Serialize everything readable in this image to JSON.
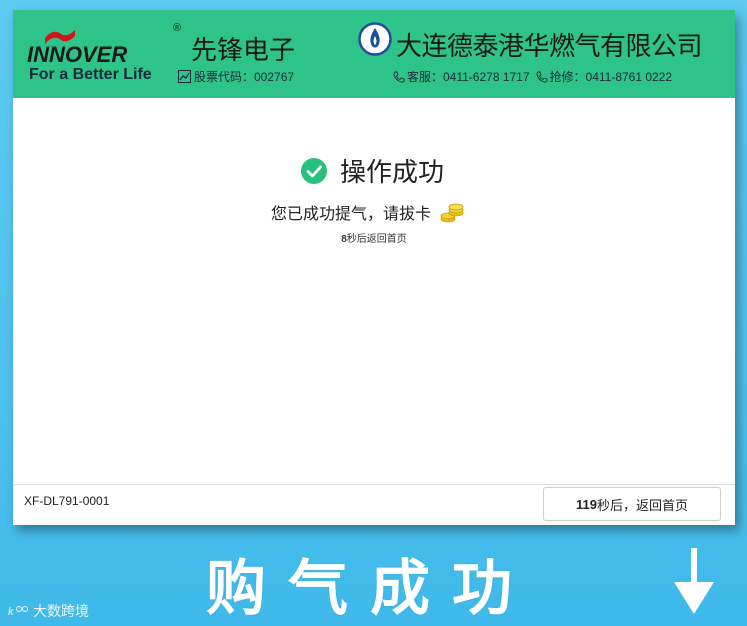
{
  "header": {
    "brand_wordmark": "INNOVER",
    "brand_reg": "®",
    "brand_cn": "先锋电子",
    "tagline": "For a Better Life",
    "stock_label": "股票代码：002767",
    "company_name": "大连德泰港华燃气有限公司",
    "service_label": "客服：0411-6278 1717",
    "emergency_label": "抢修：0411-8761 0222",
    "header_color": "#2ec388"
  },
  "main": {
    "status_title": "操作成功",
    "message": "您已成功提气，请拔卡",
    "auto_return_seconds": "8",
    "auto_return_text": "秒后返回首页",
    "success_color": "#27c07d"
  },
  "footer": {
    "device_id": "XF-DL791-0001",
    "return_seconds": "119",
    "return_text": "秒后，返回首页"
  },
  "banner": {
    "caption": "购气成功",
    "watermark": "大数跨境"
  },
  "icons": {
    "stock": "chart-icon",
    "service": "phone-icon",
    "emergency": "phone-icon",
    "status": "check-circle-icon",
    "coins": "coins-icon",
    "company": "gas-flame-logo-icon",
    "arrow": "arrow-down-icon"
  }
}
